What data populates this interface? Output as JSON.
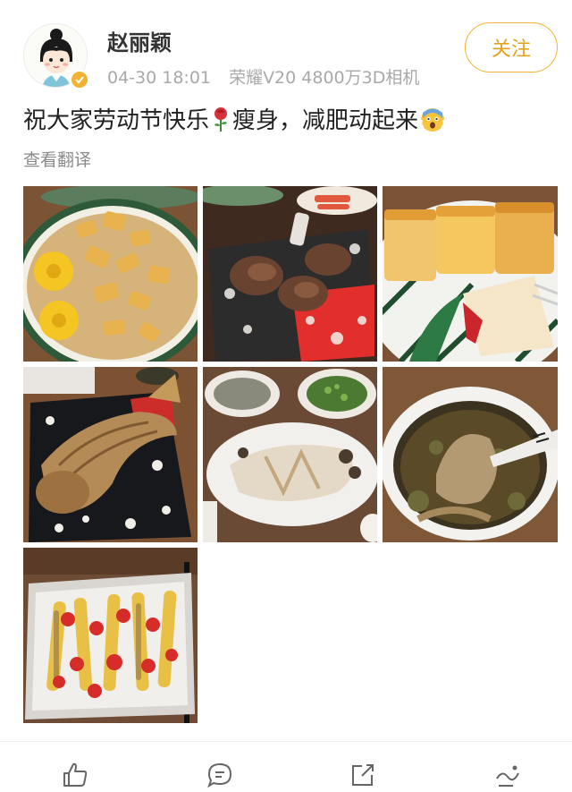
{
  "user": {
    "name": "赵丽颖",
    "post_time": "04-30 18:01",
    "device": "荣耀V20 4800万3D相机"
  },
  "follow_button": {
    "label": "关注"
  },
  "post": {
    "text_part1": "祝大家劳动节快乐",
    "text_part2": "瘦身，减肥动起来",
    "emoji_1": "rose-emoji",
    "emoji_2": "shocked-face-emoji",
    "translate_label": "查看翻译"
  },
  "photos": [
    "fried-potatoes-and-corn-plate",
    "grilled-lamb-chops-plate",
    "toasted-bread-slices-plate",
    "fried-fish-plate",
    "shredded-chicken-and-side-dishes",
    "chicken-soup-bowl",
    "baked-vegetables-tray"
  ],
  "actions": [
    "like-icon",
    "comment-icon",
    "share-icon",
    "more-icon"
  ],
  "colors": {
    "accent": "#f2b233",
    "follow_text": "#e3a11d",
    "meta_text": "#a9a9a9",
    "body_text": "#222222"
  }
}
